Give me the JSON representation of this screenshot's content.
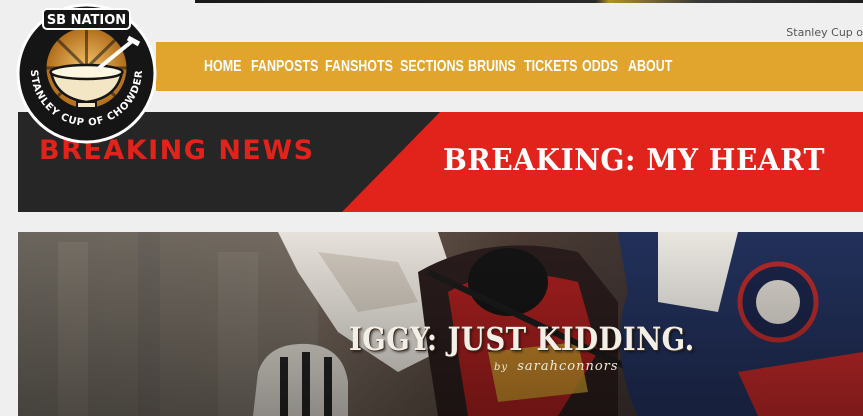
{
  "site": {
    "network_label": "SB NATION",
    "blog_name": "STANLEY CUP OF CHOWDER",
    "tagline": "Stanley Cup o"
  },
  "nav": {
    "items": [
      {
        "label": "HOME"
      },
      {
        "label": "FANPOSTS"
      },
      {
        "label": "FANSHOTS"
      },
      {
        "label": "SECTIONS"
      },
      {
        "label": "BRUINS"
      },
      {
        "label": "TICKETS"
      },
      {
        "label": "ODDS"
      },
      {
        "label": "ABOUT"
      }
    ]
  },
  "breaking": {
    "label": "BREAKING NEWS",
    "headline": "BREAKING: MY HEART"
  },
  "hero": {
    "title": "IGGY: JUST KIDDING.",
    "byline_prefix": "by",
    "author": "sarahconnors"
  },
  "colors": {
    "nav_bg": "#e1a42d",
    "breaking_red": "#e1231b",
    "breaking_dark": "#262626",
    "page_bg": "#efefef"
  }
}
